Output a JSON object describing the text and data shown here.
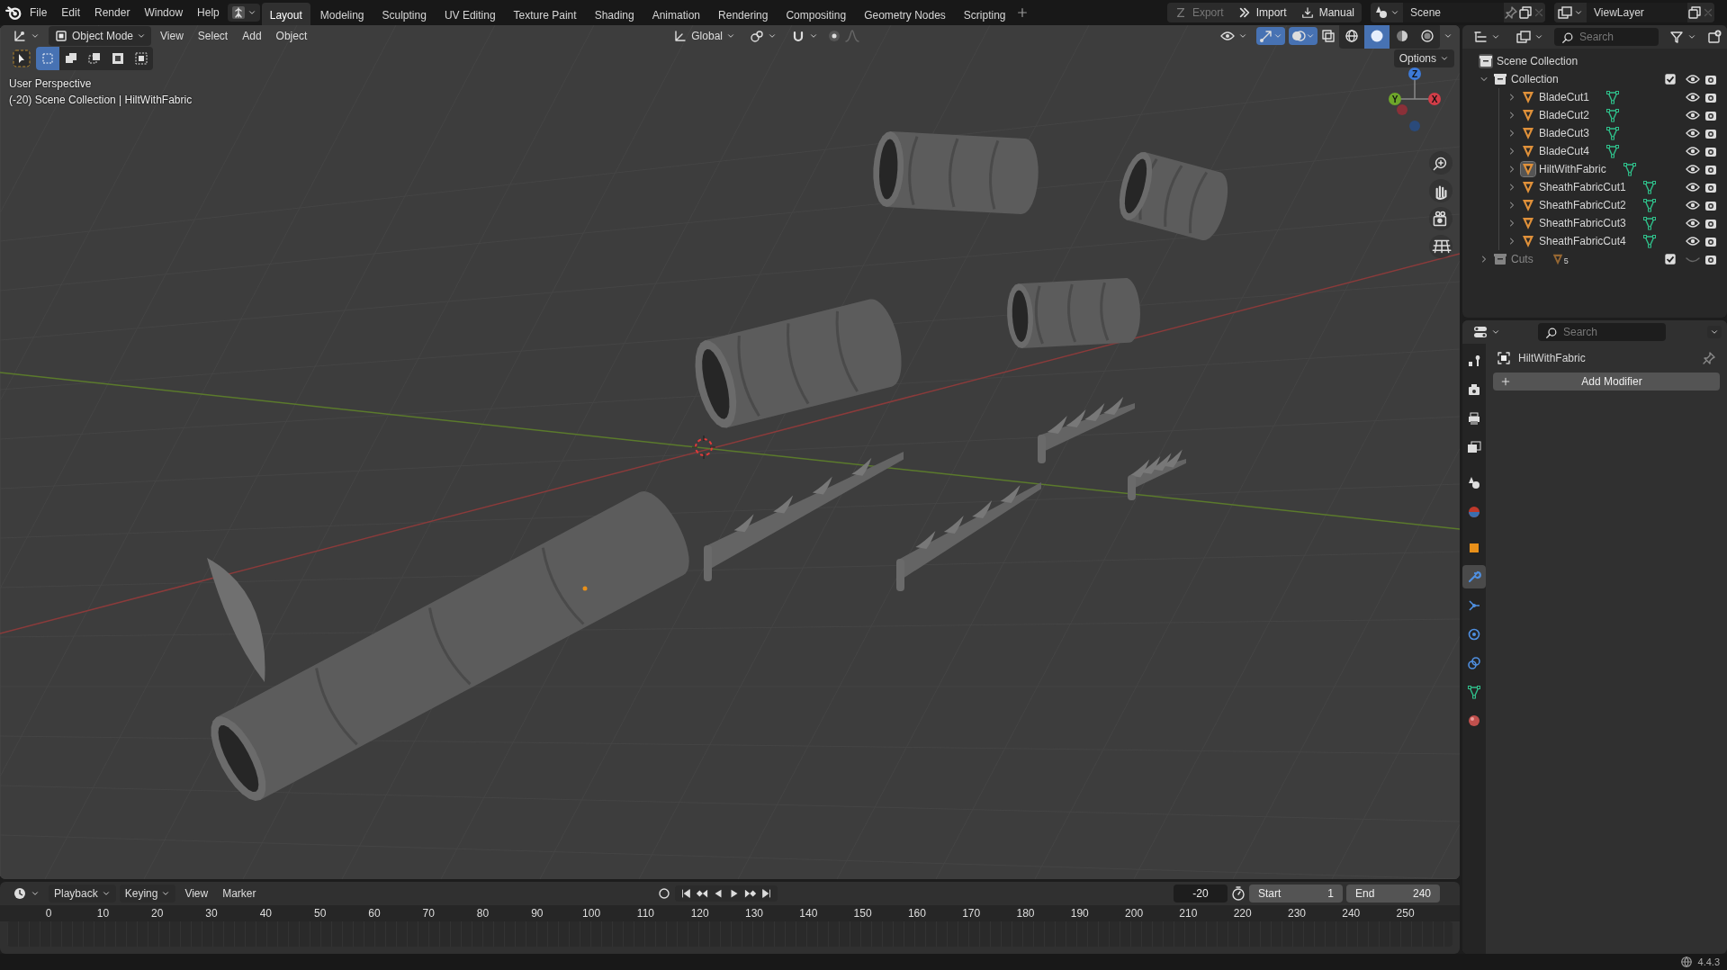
{
  "top_bar": {
    "menus": [
      "File",
      "Edit",
      "Render",
      "Window",
      "Help"
    ],
    "workspaces": [
      {
        "label": "Layout",
        "selected": true
      },
      {
        "label": "Modeling",
        "selected": false
      },
      {
        "label": "Sculpting",
        "selected": false
      },
      {
        "label": "UV Editing",
        "selected": false
      },
      {
        "label": "Texture Paint",
        "selected": false
      },
      {
        "label": "Shading",
        "selected": false
      },
      {
        "label": "Animation",
        "selected": false
      },
      {
        "label": "Rendering",
        "selected": false
      },
      {
        "label": "Compositing",
        "selected": false
      },
      {
        "label": "Geometry Nodes",
        "selected": false
      },
      {
        "label": "Scripting",
        "selected": false
      }
    ],
    "export": {
      "label": "Export",
      "disabled": true
    },
    "import": {
      "label": "Import",
      "disabled": false
    },
    "manual": {
      "label": "Manual",
      "disabled": false
    },
    "scene": "Scene",
    "view_layer": "ViewLayer"
  },
  "viewport": {
    "mode": "Object Mode",
    "menus": [
      "View",
      "Select",
      "Add",
      "Object"
    ],
    "orientation": "Global",
    "options": "Options",
    "select_modes": [
      {
        "kind": "set",
        "selected": true
      },
      {
        "kind": "extend",
        "selected": false
      },
      {
        "kind": "subtract",
        "selected": false
      },
      {
        "kind": "invert",
        "selected": false
      },
      {
        "kind": "intersect",
        "selected": false
      }
    ],
    "shading_modes": [
      {
        "kind": "wireframe",
        "selected": false
      },
      {
        "kind": "solid",
        "selected": true
      },
      {
        "kind": "material",
        "selected": false
      },
      {
        "kind": "rendered",
        "selected": false
      }
    ],
    "info": [
      "User Perspective",
      "(-20) Scene Collection | HiltWithFabric"
    ],
    "gizmo_axes": [
      {
        "label": "Z",
        "color": "#3d7ad8"
      },
      {
        "label": "Y",
        "color": "#6ea62a"
      },
      {
        "label": "X",
        "color": "#d23d48"
      }
    ]
  },
  "outliner": {
    "search_placeholder": "Search",
    "root": "Scene Collection",
    "collections": [
      {
        "name": "Collection",
        "expanded": true,
        "checked": true,
        "visible": true,
        "children": [
          {
            "name": "BladeCut1",
            "selected": false
          },
          {
            "name": "BladeCut2",
            "selected": false
          },
          {
            "name": "BladeCut3",
            "selected": false
          },
          {
            "name": "BladeCut4",
            "selected": false
          },
          {
            "name": "HiltWithFabric",
            "selected": true
          },
          {
            "name": "SheathFabricCut1",
            "selected": false
          },
          {
            "name": "SheathFabricCut2",
            "selected": false
          },
          {
            "name": "SheathFabricCut3",
            "selected": false
          },
          {
            "name": "SheathFabricCut4",
            "selected": false
          }
        ]
      },
      {
        "name": "Cuts",
        "expanded": false,
        "checked": true,
        "visible": false,
        "count": "5"
      }
    ]
  },
  "properties": {
    "search_placeholder": "Search",
    "object_name": "HiltWithFabric",
    "add_modifier": "Add Modifier",
    "tabs": [
      {
        "kind": "tool",
        "selected": false
      },
      {
        "kind": "render",
        "selected": false
      },
      {
        "kind": "output",
        "selected": false
      },
      {
        "kind": "view_layer",
        "selected": false
      },
      {
        "kind": "scene",
        "selected": false
      },
      {
        "kind": "world",
        "selected": false
      },
      {
        "kind": "object",
        "selected": false
      },
      {
        "kind": "modifiers",
        "selected": true
      },
      {
        "kind": "particles",
        "selected": false
      },
      {
        "kind": "physics",
        "selected": false
      },
      {
        "kind": "constraints",
        "selected": false
      },
      {
        "kind": "data",
        "selected": false
      },
      {
        "kind": "material",
        "selected": false
      }
    ]
  },
  "timeline": {
    "menus": [
      {
        "label": "Playback",
        "dropdown": true
      },
      {
        "label": "Keying",
        "dropdown": true
      },
      {
        "label": "View",
        "dropdown": false
      },
      {
        "label": "Marker",
        "dropdown": false
      }
    ],
    "current_frame": "-20",
    "start": {
      "label": "Start",
      "value": "1"
    },
    "end": {
      "label": "End",
      "value": "240"
    },
    "ticks": [
      "0",
      "10",
      "20",
      "30",
      "40",
      "50",
      "60",
      "70",
      "80",
      "90",
      "100",
      "110",
      "120",
      "130",
      "140",
      "150",
      "160",
      "170",
      "180",
      "190",
      "200",
      "210",
      "220",
      "230",
      "240",
      "250"
    ]
  },
  "status_bar": {
    "version": "4.4.3"
  }
}
